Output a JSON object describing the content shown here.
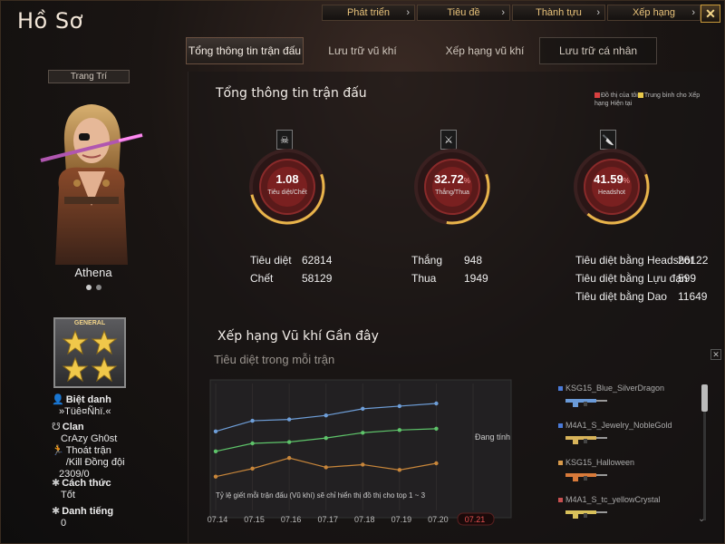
{
  "title": "Hồ Sơ",
  "top_nav": [
    "Phát triển",
    "Tiêu đề",
    "Thành tựu",
    "Xếp hạng"
  ],
  "tabs": [
    "Tổng thông tin trận đấu",
    "Lưu trữ vũ khí",
    "Xếp hạng vũ khí",
    "Lưu trữ cá nhân"
  ],
  "left": {
    "decor_button": "Trang Trí",
    "character_name": "Athena",
    "rank_label": "GENERAL",
    "nickname_label": "Biệt danh",
    "nickname_value": "»Tüê¤Ñhï.«",
    "clan_label": "Clan",
    "clan_value": "CrAzy Gh0st",
    "teammates_label": "Thoát trận /Kill Đồng đội",
    "teammates_value": "2309/0",
    "manner_label": "Cách thức",
    "manner_value": "Tốt",
    "fame_label": "Danh tiếng",
    "fame_value": "0"
  },
  "overview": {
    "title": "Tổng thông tin trận đấu",
    "legend_mine": "Đồ thị của tôi",
    "legend_avg": "Trung bình cho Xếp hạng Hiện tại",
    "gauges": [
      {
        "value": "1.08",
        "unit": "",
        "label": "Tiêu diệt/Chết",
        "level": 0.52
      },
      {
        "value": "32.72",
        "unit": "%",
        "label": "Thắng/Thua",
        "level": 0.33
      },
      {
        "value": "41.59",
        "unit": "%",
        "label": "Headshot",
        "level": 0.42
      }
    ],
    "stats": {
      "kills_label": "Tiêu diệt",
      "kills": "62814",
      "deaths_label": "Chết",
      "deaths": "58129",
      "wins_label": "Thắng",
      "wins": "948",
      "losses_label": "Thua",
      "losses": "1949",
      "hs_label": "Tiêu diệt bằng Headshot",
      "hs": "26122",
      "grenade_label": "Tiêu diệt bằng Lựu đạn",
      "grenade": "599",
      "knife_label": "Tiêu diệt bằng Dao",
      "knife": "11649"
    }
  },
  "recent": {
    "title": "Xếp hạng Vũ khí Gần đây",
    "subtitle": "Tiêu diệt trong mỗi trận",
    "loading": "Đang tính",
    "note": "Tỷ lệ giết mỗi trận đấu (Vũ khí) sẽ chỉ hiển thị đồ thị cho top 1 ~ 3"
  },
  "chart_data": {
    "type": "line",
    "x": [
      "07.14",
      "07.15",
      "07.16",
      "07.17",
      "07.18",
      "07.19",
      "07.20",
      "07.21"
    ],
    "selected_x": "07.21",
    "series": [
      {
        "name": "KSG15_Blue_SilverDragon",
        "color": "#6e9ed8",
        "values": [
          5.4,
          6.2,
          6.3,
          6.6,
          7.1,
          7.3,
          7.5,
          null
        ]
      },
      {
        "name": "M4A1_S_Jewelry_NobleGold",
        "color": "#5ec46a",
        "values": [
          3.9,
          4.5,
          4.6,
          4.9,
          5.3,
          5.5,
          5.6,
          null
        ]
      },
      {
        "name": "KSG15_Halloween",
        "color": "#c8863a",
        "values": [
          2.0,
          2.6,
          3.4,
          2.7,
          2.9,
          2.5,
          3.0,
          null
        ]
      }
    ],
    "extra_legend": {
      "name": "M4A1_S_tc_yellowCrystal",
      "color": "#c85050"
    },
    "ylim": [
      0,
      9
    ]
  },
  "weapons": [
    {
      "name": "KSG15_Blue_SilverDragon",
      "color": "#4a7ad8",
      "gun": "#6a9ad8"
    },
    {
      "name": "M4A1_S_Jewelry_NobleGold",
      "color": "#4a7ad8",
      "gun": "#d8b45a"
    },
    {
      "name": "KSG15_Halloween",
      "color": "#d89a4a",
      "gun": "#d87a3a"
    },
    {
      "name": "M4A1_S_tc_yellowCrystal",
      "color": "#c85050",
      "gun": "#d8c05a"
    }
  ]
}
